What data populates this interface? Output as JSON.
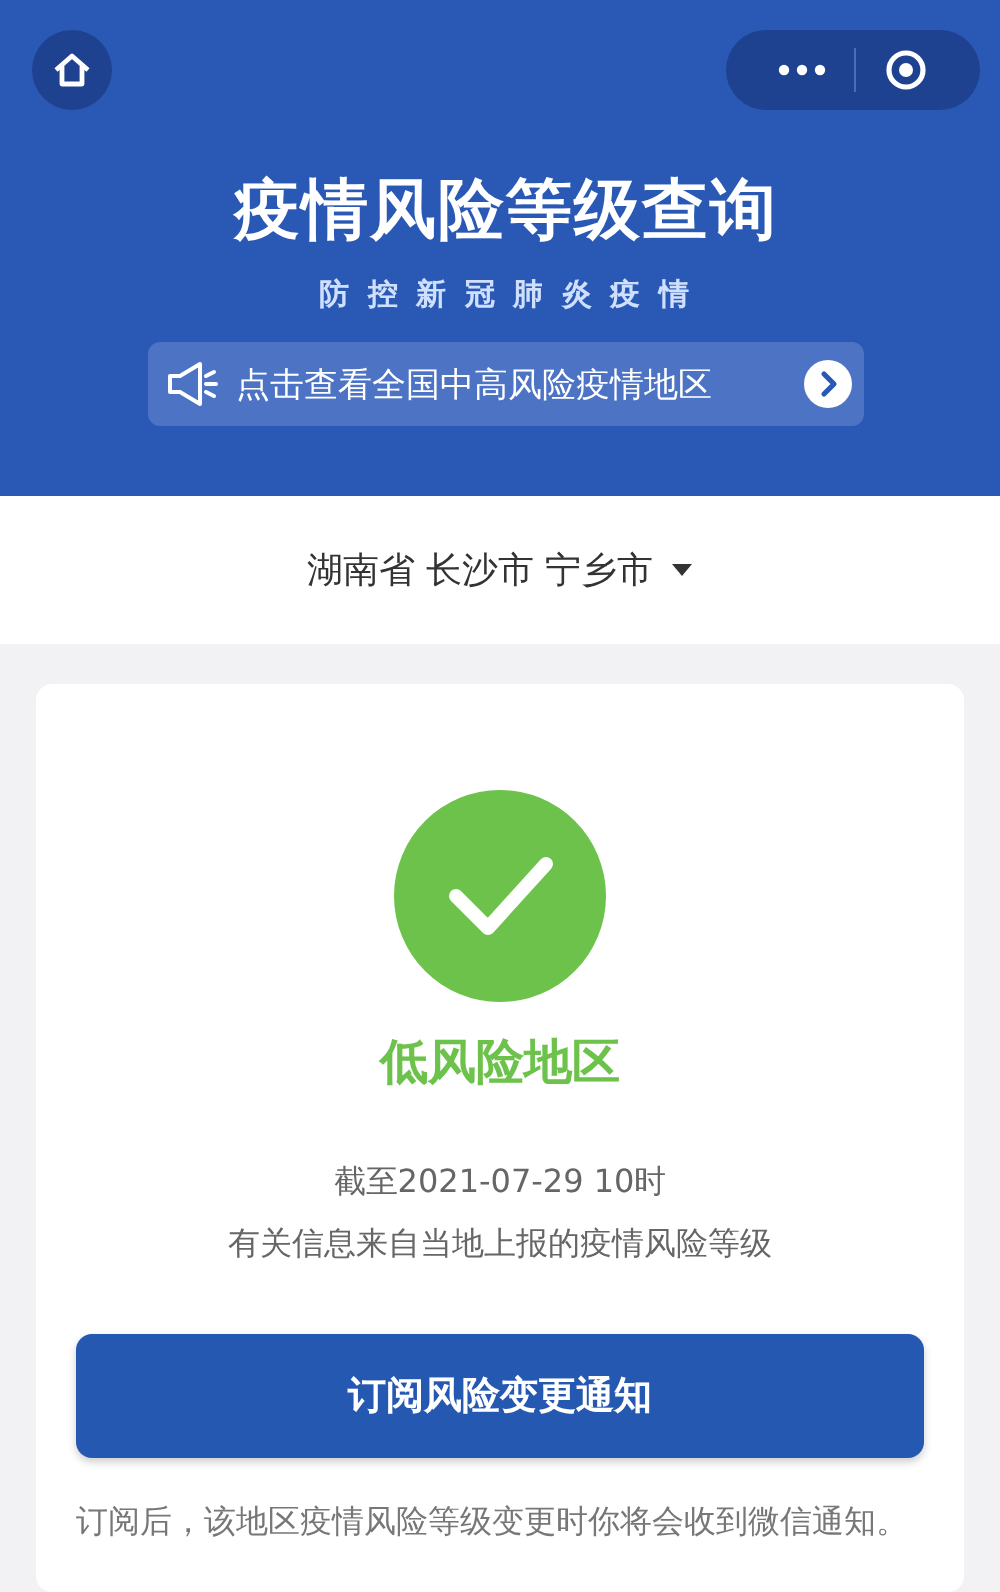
{
  "header": {
    "title": "疫情风险等级查询",
    "subtitle": "防 控 新 冠 肺 炎 疫 情",
    "notice": "点击查看全国中高风险疫情地区"
  },
  "location": {
    "text": "湖南省 长沙市 宁乡市"
  },
  "result": {
    "kind": "check",
    "label": "低风险地区",
    "as_of": "截至2021-07-29 10时",
    "source": "有关信息来自当地上报的疫情风险等级"
  },
  "subscribe_button": "订阅风险变更通知",
  "note": "订阅后，该地区疫情风险等级变更时你将会收到微信通知。"
}
